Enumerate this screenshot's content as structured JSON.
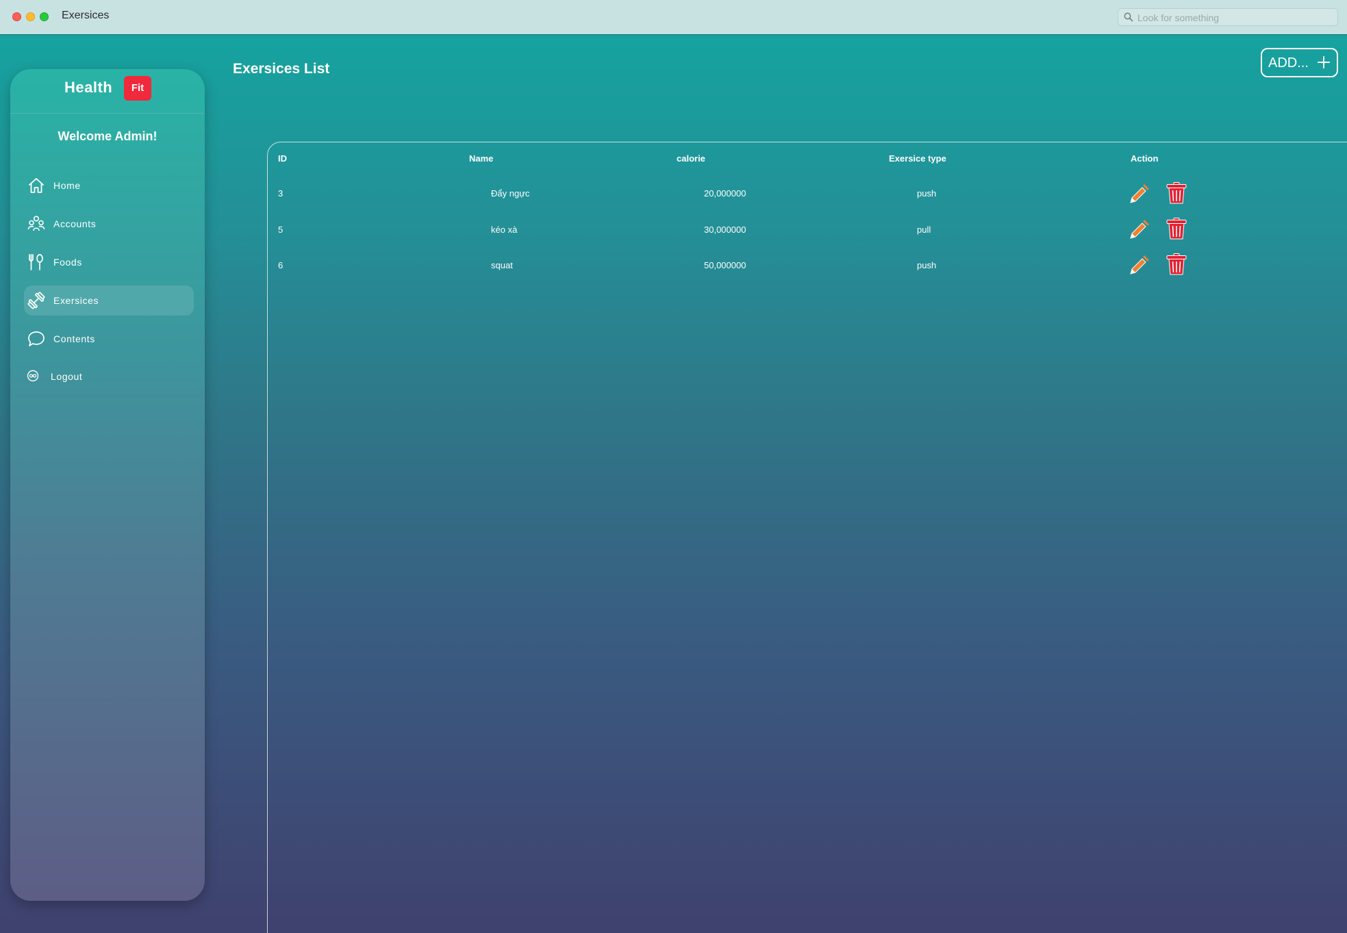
{
  "window": {
    "title": "Exersices",
    "search_placeholder": "Look for something"
  },
  "sidebar": {
    "brand": "Health",
    "brand_badge": "Fit",
    "welcome": "Welcome Admin!",
    "items": [
      {
        "label": "Home",
        "icon": "home-icon"
      },
      {
        "label": "Accounts",
        "icon": "accounts-icon"
      },
      {
        "label": "Foods",
        "icon": "fork-spoon-icon"
      },
      {
        "label": "Exersices",
        "icon": "dumbbell-icon",
        "active": true
      },
      {
        "label": "Contents",
        "icon": "chat-bubble-icon"
      },
      {
        "label": "Logout",
        "icon": "logout-icon"
      }
    ]
  },
  "main": {
    "title": "Exersices List",
    "add_label": "ADD...",
    "table": {
      "headers": [
        "ID",
        "Name",
        "calorie",
        "Exersice type",
        "Action"
      ],
      "rows": [
        {
          "id": "3",
          "name": "Đẩy ngực",
          "calorie": "20,000000",
          "type": "push"
        },
        {
          "id": "5",
          "name": "kéo xà",
          "calorie": "30,000000",
          "type": "pull"
        },
        {
          "id": "6",
          "name": "squat",
          "calorie": "50,000000",
          "type": "push"
        }
      ]
    }
  },
  "colors": {
    "accent": "#13a6a0",
    "badge": "#f0293d",
    "edit_icon": "#f2812f",
    "delete_icon": "#e02232"
  }
}
